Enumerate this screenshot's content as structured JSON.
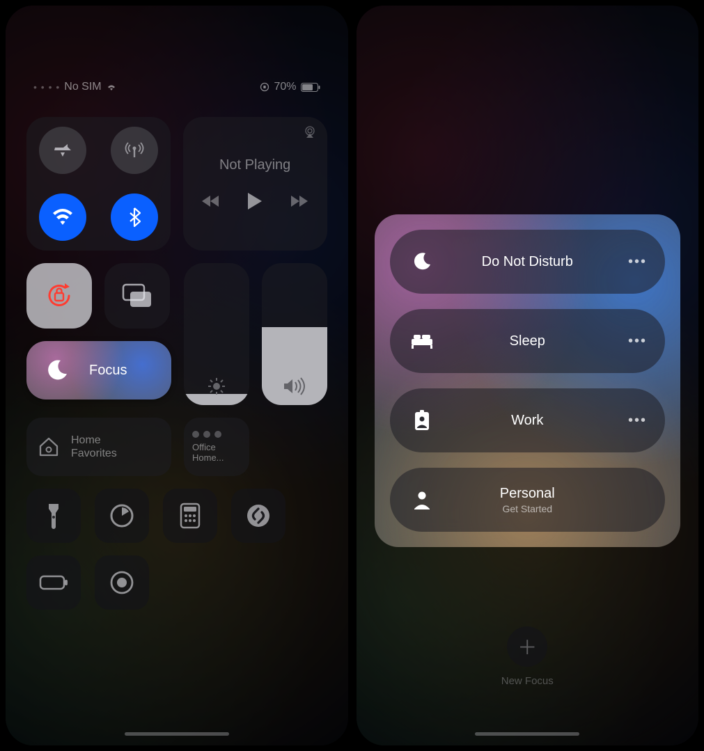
{
  "status": {
    "sim": "No SIM",
    "battery_pct": "70%"
  },
  "media": {
    "state": "Not Playing"
  },
  "focus_tile": {
    "label": "Focus"
  },
  "sliders": {
    "brightness_pct": 8,
    "volume_pct": 55
  },
  "home_tile": {
    "line1": "Home",
    "line2": "Favorites"
  },
  "office_tile": {
    "label": "Office Home..."
  },
  "focus_modes": [
    {
      "icon": "moon",
      "label": "Do Not Disturb",
      "sub": "",
      "more": true
    },
    {
      "icon": "bed",
      "label": "Sleep",
      "sub": "",
      "more": true
    },
    {
      "icon": "badge",
      "label": "Work",
      "sub": "",
      "more": true
    },
    {
      "icon": "person",
      "label": "Personal",
      "sub": "Get Started",
      "more": false
    }
  ],
  "new_focus": {
    "label": "New Focus"
  }
}
